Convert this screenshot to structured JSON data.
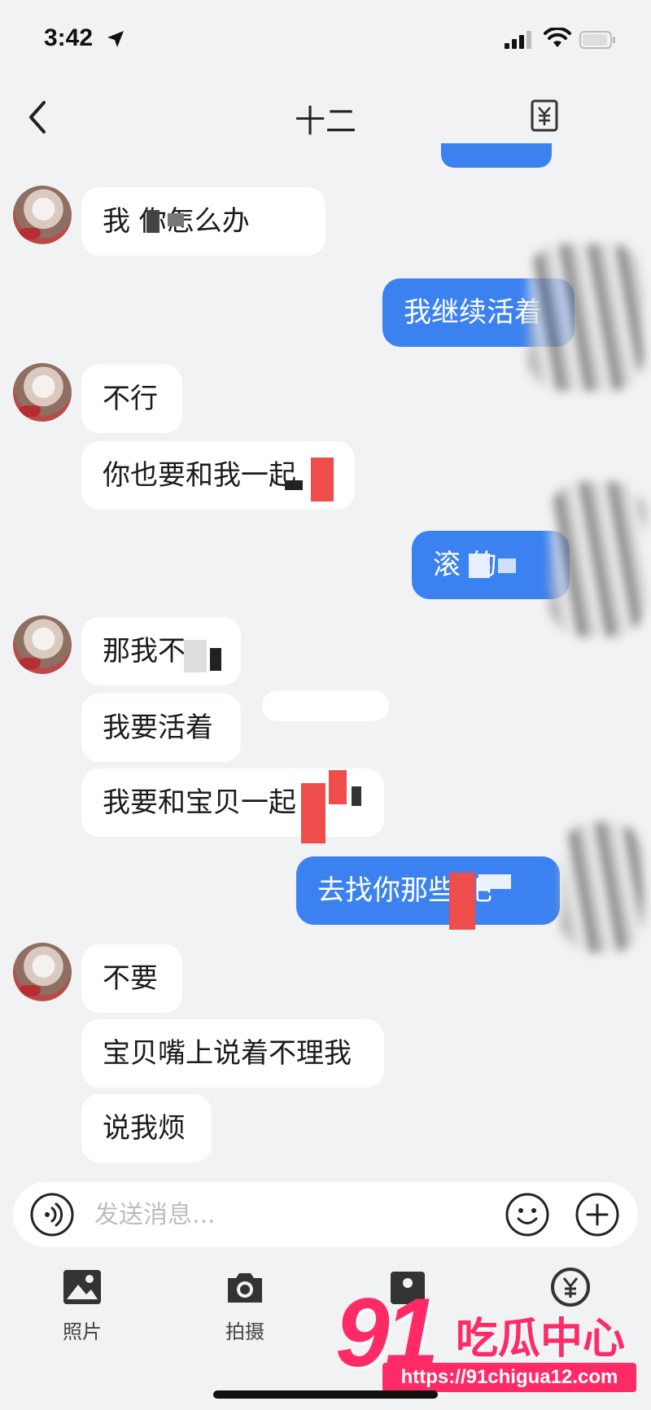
{
  "status_bar": {
    "time": "3:42"
  },
  "nav": {
    "title": "十二"
  },
  "messages": [
    {
      "side": "in",
      "text": "我 你怎么办"
    },
    {
      "side": "out",
      "text": "我继续活着"
    },
    {
      "side": "in",
      "text": "不行"
    },
    {
      "side": "in",
      "text": "你也要和我一起"
    },
    {
      "side": "out",
      "text": "滚 的"
    },
    {
      "side": "in",
      "text": "那我不"
    },
    {
      "side": "in",
      "text": "我要活着"
    },
    {
      "side": "in",
      "text": "我要和宝贝一起"
    },
    {
      "side": "out",
      "text": "去找你那些 吧"
    },
    {
      "side": "in",
      "text": "不要"
    },
    {
      "side": "in",
      "text": "宝贝嘴上说着不理我"
    },
    {
      "side": "in",
      "text": "说我烦"
    }
  ],
  "input": {
    "placeholder": "发送消息..."
  },
  "toolbar": {
    "photo_label": "照片",
    "camera_label": "拍摄",
    "third_label": "",
    "fourth_label": ""
  },
  "watermark": {
    "number": "91",
    "name": "吃瓜中心",
    "url": "https://91chigua12.com"
  },
  "colors": {
    "outgoing_bubble": "#3b82f0",
    "incoming_bubble": "#ffffff",
    "background": "#f1f2f4",
    "watermark": "#ff2a66"
  }
}
